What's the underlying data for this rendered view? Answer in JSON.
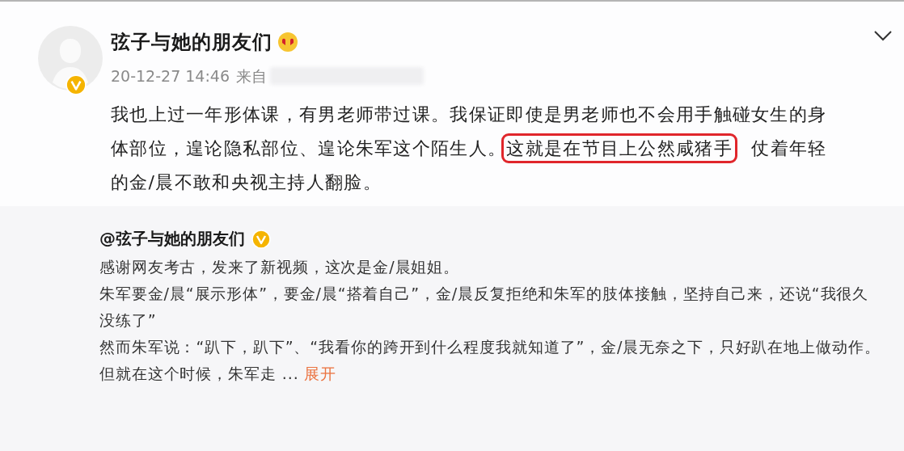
{
  "post": {
    "author": "弦子与她的朋友们",
    "verified": true,
    "time": "20-12-27 14:46",
    "source_label": "来自",
    "body": [
      {
        "text": "我也上过一年形体课，有男老师带过课。我保证即使是男老师也不会用手触碰女生的身体部位，遑论隐私部位、遑论朱军这个陌生人。",
        "highlighted": false
      },
      {
        "text": "这就是在节目上公然咸猪手",
        "highlighted": true
      },
      {
        "text": "　仗着年轻的金/晨不敢和央视主持人翻脸。",
        "highlighted": false
      }
    ]
  },
  "quoted": {
    "author": "@弦子与她的朋友们",
    "verified": true,
    "paragraphs": [
      "感谢网友考古，发来了新视频，这次是金/晨姐姐。",
      "朱军要金/晨“展示形体”，要金/晨“搭着自己”，金/晨反复拒绝和朱军的肢体接触，坚持自己来，还说“我很久没练了”",
      "然而朱军说：“趴下，趴下”、“我看你的跨开到什么程度我就知道了”，金/晨无奈之下，只好趴在地上做动作。"
    ],
    "truncated_text": "但就在这个时候，朱军走 ...",
    "expand_link": "展开"
  }
}
